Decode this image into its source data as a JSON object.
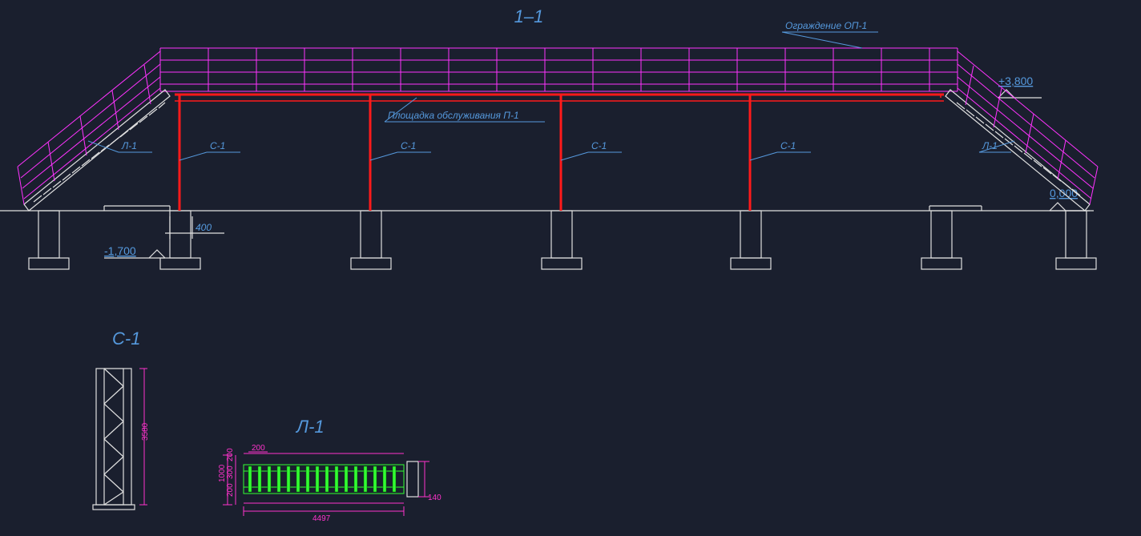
{
  "section": {
    "title": "1–1",
    "railing_label": "Ограждение ОП-1",
    "platform_label": "Площадка обслуживания П-1",
    "column_label": "С-1",
    "stair_label": "Л-1",
    "elevations": {
      "top": "+3,800",
      "ground": "0,000",
      "foundation": "-1,700"
    },
    "dim_base": "400"
  },
  "detail_c": {
    "title": "С-1",
    "height": "3580"
  },
  "detail_l": {
    "title": "Л-1",
    "dims": {
      "width_total": "4497",
      "rung": "200",
      "side1": "200",
      "mid": "300",
      "side2": "200",
      "depth": "1000",
      "end": "140"
    }
  }
}
